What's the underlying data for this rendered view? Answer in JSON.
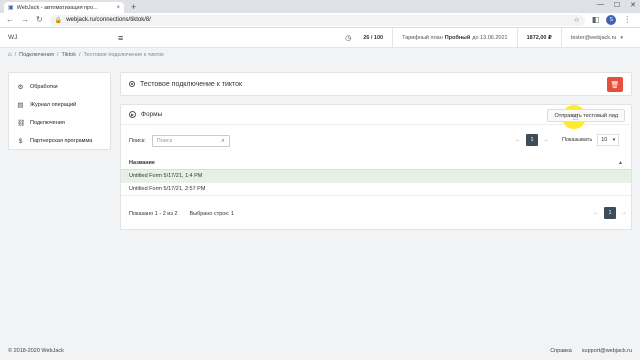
{
  "browser": {
    "tab_title": "WebJack - автоматизация про...",
    "tab_close": "×",
    "new_tab": "+",
    "url": "webjack.ru/connections/tiktok/8/",
    "window_controls": [
      "—",
      "☐",
      "✕"
    ],
    "profile_initial": "S"
  },
  "header": {
    "logo": "WJ",
    "leads": "26 / 100",
    "plan_prefix": "Тарифный план",
    "plan_name": "Пробный",
    "plan_until": "до 13.06.2021",
    "balance": "1872,00 ₽",
    "user": "tester@webjack.ru"
  },
  "breadcrumb": {
    "items": [
      "Подключения",
      "Tiktok"
    ],
    "current": "Тестовое подключение к тикток"
  },
  "sidebar": {
    "items": [
      {
        "label": "Обработки",
        "icon": "gear-icon"
      },
      {
        "label": "Журнал операций",
        "icon": "log-icon"
      },
      {
        "label": "Подключения",
        "icon": "link-icon"
      },
      {
        "label": "Партнерская программа",
        "icon": "dollar-icon"
      }
    ]
  },
  "connection": {
    "title": "Тестовое подключение к тикток"
  },
  "forms": {
    "title": "Формы",
    "send_lead_label": "Отправить тестовый лид",
    "search_label": "Поиск:",
    "search_placeholder": "Поиск",
    "page_current": "1",
    "show_label": "Показывать",
    "page_size": "10",
    "column_name": "Название",
    "rows": [
      {
        "name": "Untitled Form 5/17/21, 1:4 PM",
        "selected": true
      },
      {
        "name": "Untitled Form 5/17/21, 2:57 PM",
        "selected": false
      }
    ],
    "shown_info": "Показано 1 - 2 из 2",
    "selected_info": "Выбрано строк: 1"
  },
  "footer": {
    "copyright": "© 2018-2020 WebJack",
    "help": "Справка",
    "support": "support@webjack.ru"
  },
  "colors": {
    "accent_dark": "#3d4d5a",
    "delete_red": "#e5503a",
    "row_selected": "#e5f2e3",
    "cursor_highlight": "#ffe800"
  }
}
